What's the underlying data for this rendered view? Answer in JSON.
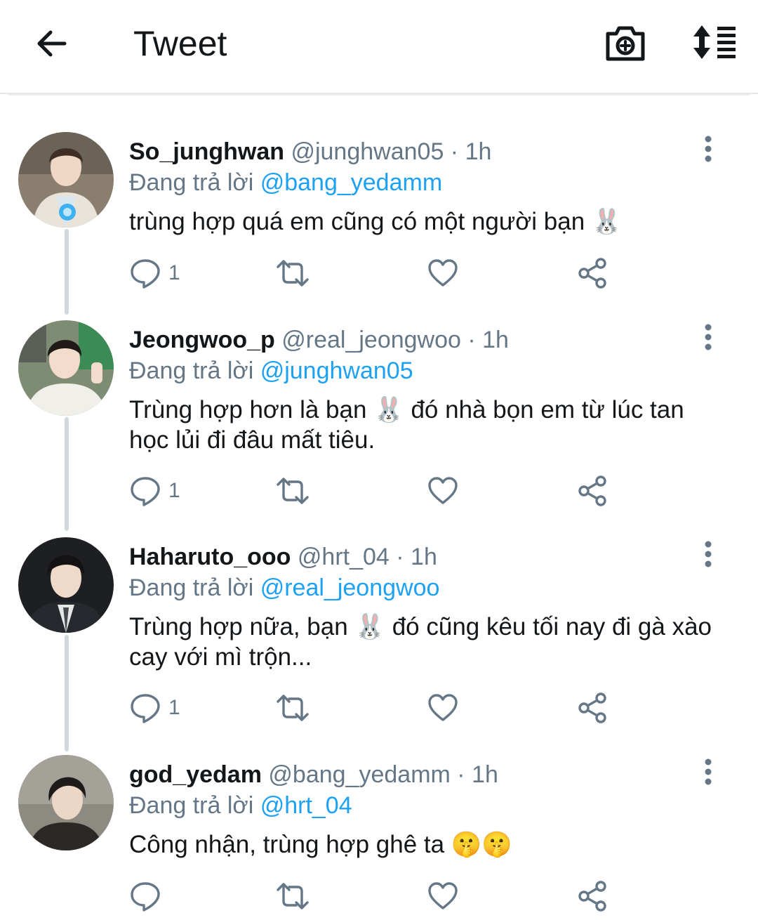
{
  "header": {
    "title": "Tweet"
  },
  "icons": {
    "back": "arrow-left-icon",
    "camera": "camera-add-icon",
    "sort": "sort-icon",
    "reply": "reply-icon",
    "retweet": "retweet-icon",
    "like": "heart-icon",
    "share": "share-icon",
    "more": "more-vertical-icon"
  },
  "colors": {
    "link": "#1da1f2",
    "muted": "#657786",
    "line": "#cfd9de"
  },
  "tweets": [
    {
      "name": "So_junghwan",
      "meta": "@junghwan05 · 1h",
      "reply_prefix": "Đang trả lời ",
      "reply_to": "@bang_yedamm",
      "text": "trùng hợp quá em cũng có một người bạn 🐰",
      "reply_count": "1"
    },
    {
      "name": "Jeongwoo_p",
      "meta": "@real_jeongwoo · 1h",
      "reply_prefix": "Đang trả lời ",
      "reply_to": "@junghwan05",
      "text": "Trùng hợp hơn là bạn 🐰 đó nhà bọn em từ lúc tan học lủi đi đâu mất tiêu.",
      "reply_count": "1"
    },
    {
      "name": "Haharuto_ooo",
      "meta": "@hrt_04 · 1h",
      "reply_prefix": "Đang trả lời ",
      "reply_to": "@real_jeongwoo",
      "text": "Trùng hợp nữa, bạn 🐰 đó cũng kêu tối nay đi gà xào cay với mì trộn...",
      "reply_count": "1"
    },
    {
      "name": "god_yedam",
      "meta": "@bang_yedamm · 1h",
      "reply_prefix": "Đang trả lời ",
      "reply_to": "@hrt_04",
      "text": "Công nhận, trùng hợp ghê ta 🤫🤫",
      "reply_count": ""
    }
  ]
}
